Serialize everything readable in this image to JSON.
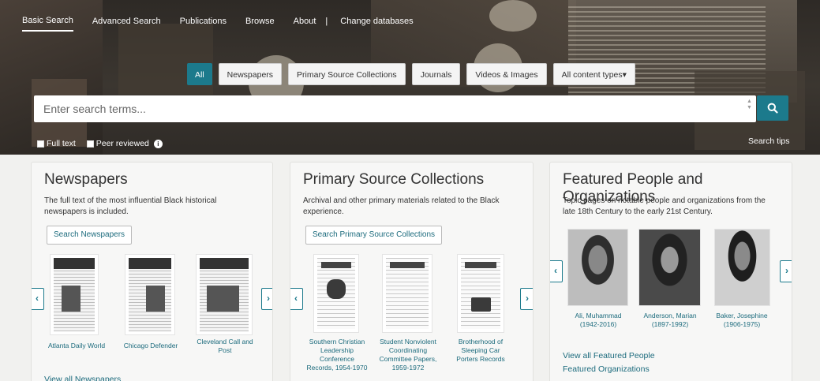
{
  "nav": {
    "items": [
      "Basic Search",
      "Advanced Search",
      "Publications",
      "Browse",
      "About"
    ],
    "separator": "|",
    "change_db": "Change databases"
  },
  "filters": [
    "All",
    "Newspapers",
    "Primary Source Collections",
    "Journals",
    "Videos & Images",
    "All content types▾"
  ],
  "search": {
    "placeholder": "Enter search terms..."
  },
  "options": {
    "full_text": "Full text",
    "peer_reviewed": "Peer reviewed",
    "tips": "Search tips"
  },
  "newspapers": {
    "title": "Newspapers",
    "desc1": "The full text of the most influential Black historical",
    "desc2": "newspapers is included.",
    "button": "Search Newspapers",
    "items": [
      "Atlanta Daily World",
      "Chicago Defender",
      "Cleveland Call and",
      "Post"
    ],
    "view_all": "View all Newspapers"
  },
  "primary": {
    "title": "Primary Source Collections",
    "desc1": "Archival and other primary materials related to the Black",
    "desc2": "experience.",
    "button": "Search Primary Source Collections",
    "items": [
      [
        "Southern Christian",
        "Leadership",
        "Conference",
        "Records, 1954-1970"
      ],
      [
        "Student Nonviolent",
        "Coordinating",
        "Committee Papers,",
        "1959-1972"
      ],
      [
        "Brotherhood of",
        "Sleeping Car",
        "Porters Records"
      ]
    ]
  },
  "people": {
    "title": "Featured People and Organizations",
    "desc1": "Topic pages on notable people and organizations from the",
    "desc2": "late 18th Century to the early 21st Century.",
    "items": [
      [
        "Ali, Muhammad",
        "(1942-2016)"
      ],
      [
        "Anderson, Marian",
        "(1897-1992)"
      ],
      [
        "Baker, Josephine",
        "(1906-1975)"
      ]
    ],
    "view_people": "View all Featured People",
    "view_orgs": "Featured Organizations"
  },
  "colors": {
    "accent": "#1c7a8c",
    "link": "#1c6b7d"
  },
  "icons": {
    "search": "search-icon",
    "prev": "chevron-left-icon",
    "next": "chevron-right-icon",
    "info": "info-icon"
  }
}
